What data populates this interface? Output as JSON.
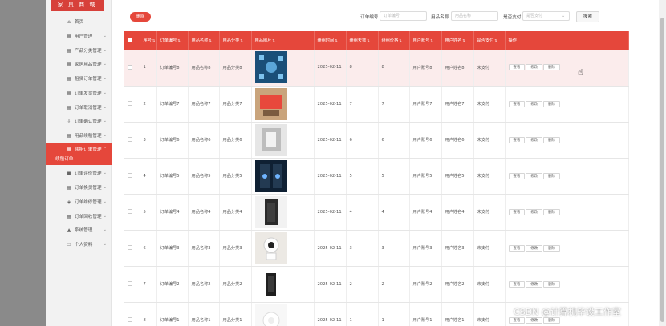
{
  "sidebar": {
    "logo": "家 具 商 城",
    "items": [
      {
        "label": "首页",
        "icon": "⌂",
        "chev": ""
      },
      {
        "label": "用户管理",
        "icon": "▦",
        "chev": "⌄"
      },
      {
        "label": "产品分类管理",
        "icon": "▦",
        "chev": "⌄"
      },
      {
        "label": "家居用品管理",
        "icon": "▦",
        "chev": "⌄"
      },
      {
        "label": "租赁订单管理",
        "icon": "▦",
        "chev": "⌄"
      },
      {
        "label": "订单发货管理",
        "icon": "▦",
        "chev": "⌄"
      },
      {
        "label": "订单取消管理",
        "icon": "▦",
        "chev": "⌄"
      },
      {
        "label": "订单确认管理",
        "icon": "⇩",
        "chev": "⌄"
      },
      {
        "label": "用品续租管理",
        "icon": "▦",
        "chev": "⌄"
      },
      {
        "label": "续租订单管理",
        "icon": "▦",
        "chev": "⌃"
      }
    ],
    "sub_active": "续租订单",
    "items2": [
      {
        "label": "订单评价管理",
        "icon": "◼",
        "chev": "⌄"
      },
      {
        "label": "订单换货管理",
        "icon": "▦",
        "chev": "⌄"
      },
      {
        "label": "订单维修管理",
        "icon": "◈",
        "chev": "⌄"
      },
      {
        "label": "订单回收管理",
        "icon": "▦",
        "chev": "⌄"
      },
      {
        "label": "系统管理",
        "icon": "▲",
        "chev": "⌄"
      },
      {
        "label": "个人资料",
        "icon": "▭",
        "chev": "⌄"
      }
    ]
  },
  "toolbar": {
    "delete_label": "删除",
    "order_no_label": "订单编号",
    "order_no_placeholder": "订单编号",
    "item_name_label": "用品名称",
    "item_name_placeholder": "用品名称",
    "paid_label": "是否支付",
    "paid_placeholder": "是否支付",
    "search_label": "搜索"
  },
  "table": {
    "headers": [
      "",
      "序号",
      "订单编号",
      "用品名称",
      "用品分类",
      "用品图片",
      "续租时间",
      "续租天数",
      "续租价格",
      "用户账号",
      "用户姓名",
      "是否支付",
      "操作"
    ],
    "rows": [
      {
        "idx": "1",
        "order": "订单编号8",
        "name": "用品名称8",
        "cat": "用品分类8",
        "date": "2025-02-11",
        "days": "8",
        "price": "8",
        "account": "用户账号8",
        "uname": "用户姓名8",
        "paid": "未支付"
      },
      {
        "idx": "2",
        "order": "订单编号7",
        "name": "用品名称7",
        "cat": "用品分类7",
        "date": "2025-02-11",
        "days": "7",
        "price": "7",
        "account": "用户账号7",
        "uname": "用户姓名7",
        "paid": "未支付"
      },
      {
        "idx": "3",
        "order": "订单编号6",
        "name": "用品名称6",
        "cat": "用品分类6",
        "date": "2025-02-11",
        "days": "6",
        "price": "6",
        "account": "用户账号6",
        "uname": "用户姓名6",
        "paid": "未支付"
      },
      {
        "idx": "4",
        "order": "订单编号5",
        "name": "用品名称5",
        "cat": "用品分类5",
        "date": "2025-02-11",
        "days": "5",
        "price": "5",
        "account": "用户账号5",
        "uname": "用户姓名5",
        "paid": "未支付"
      },
      {
        "idx": "5",
        "order": "订单编号4",
        "name": "用品名称4",
        "cat": "用品分类4",
        "date": "2025-02-11",
        "days": "4",
        "price": "4",
        "account": "用户账号4",
        "uname": "用户姓名4",
        "paid": "未支付"
      },
      {
        "idx": "6",
        "order": "订单编号3",
        "name": "用品名称3",
        "cat": "用品分类3",
        "date": "2025-02-11",
        "days": "3",
        "price": "3",
        "account": "用户账号3",
        "uname": "用户姓名3",
        "paid": "未支付"
      },
      {
        "idx": "7",
        "order": "订单编号2",
        "name": "用品名称2",
        "cat": "用品分类2",
        "date": "2025-02-11",
        "days": "2",
        "price": "2",
        "account": "用户账号2",
        "uname": "用户姓名2",
        "paid": "未支付"
      },
      {
        "idx": "8",
        "order": "订单编号1",
        "name": "用品名称1",
        "cat": "用品分类1",
        "date": "2025-02-11",
        "days": "1",
        "price": "1",
        "account": "用户账号1",
        "uname": "用户姓名1",
        "paid": "未支付"
      }
    ],
    "actions": {
      "view": "查看",
      "edit": "修改",
      "delete": "删除"
    }
  },
  "colors": {
    "accent": "#e5473b",
    "row_highlight": "#fbecec"
  },
  "watermark": "CSDN @计算机毕设工作室"
}
